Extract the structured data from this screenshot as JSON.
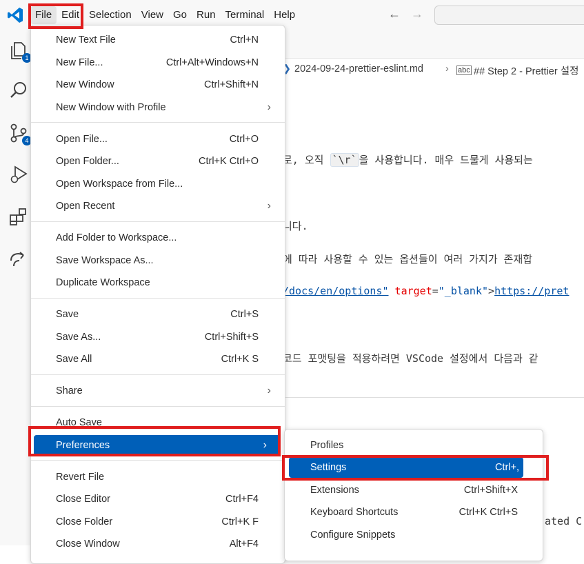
{
  "menubar": {
    "items": [
      "File",
      "Edit",
      "Selection",
      "View",
      "Go",
      "Run",
      "Terminal",
      "Help"
    ]
  },
  "activity_bar": {
    "icons": [
      "explorer-icon",
      "search-icon",
      "source-control-icon",
      "run-debug-icon",
      "extensions-icon",
      "remote-icon"
    ],
    "badges": {
      "explorer": "1",
      "source_control": "4"
    }
  },
  "breadcrumb": {
    "file": "2024-09-24-prettier-eslint.md",
    "section": "## Step 2 - Prettier 설정"
  },
  "editor": {
    "line1_pre": "로, 오직 ",
    "line1_code": "`\\r`",
    "line1_post": "을 사용합니다. 매우 드물게 사용되는",
    "line2": "니다.",
    "line3": "에 따라 사용할 수 있는 옵션들이 여러 가지가 존재합",
    "line4_link": "/docs/en/options\"",
    "line4_attr": " target",
    "line4_eq": "=",
    "line4_str": "\"_blank\"",
    "line4_gt": ">",
    "line4_link2": "https://pret",
    "line5": "코드 포맷팅을 적용하려면 VSCode 설정에서 다음과 같",
    "line6": "ated C"
  },
  "file_menu": {
    "new_text_file": {
      "label": "New Text File",
      "key": "Ctrl+N"
    },
    "new_file": {
      "label": "New File...",
      "key": "Ctrl+Alt+Windows+N"
    },
    "new_window": {
      "label": "New Window",
      "key": "Ctrl+Shift+N"
    },
    "new_window_profile": {
      "label": "New Window with Profile"
    },
    "open_file": {
      "label": "Open File...",
      "key": "Ctrl+O"
    },
    "open_folder": {
      "label": "Open Folder...",
      "key": "Ctrl+K Ctrl+O"
    },
    "open_workspace": {
      "label": "Open Workspace from File..."
    },
    "open_recent": {
      "label": "Open Recent"
    },
    "add_folder": {
      "label": "Add Folder to Workspace..."
    },
    "save_workspace_as": {
      "label": "Save Workspace As..."
    },
    "duplicate_workspace": {
      "label": "Duplicate Workspace"
    },
    "save": {
      "label": "Save",
      "key": "Ctrl+S"
    },
    "save_as": {
      "label": "Save As...",
      "key": "Ctrl+Shift+S"
    },
    "save_all": {
      "label": "Save All",
      "key": "Ctrl+K S"
    },
    "share": {
      "label": "Share"
    },
    "auto_save": {
      "label": "Auto Save"
    },
    "preferences": {
      "label": "Preferences"
    },
    "revert_file": {
      "label": "Revert File"
    },
    "close_editor": {
      "label": "Close Editor",
      "key": "Ctrl+F4"
    },
    "close_folder": {
      "label": "Close Folder",
      "key": "Ctrl+K F"
    },
    "close_window": {
      "label": "Close Window",
      "key": "Alt+F4"
    }
  },
  "preferences_menu": {
    "profiles": {
      "label": "Profiles"
    },
    "settings": {
      "label": "Settings",
      "key": "Ctrl+,"
    },
    "extensions": {
      "label": "Extensions",
      "key": "Ctrl+Shift+X"
    },
    "keyboard_shortcuts": {
      "label": "Keyboard Shortcuts",
      "key": "Ctrl+K Ctrl+S"
    },
    "configure_snippets": {
      "label": "Configure Snippets"
    }
  },
  "colors": {
    "accent": "#005fb8",
    "highlight": "#e01e1e"
  }
}
